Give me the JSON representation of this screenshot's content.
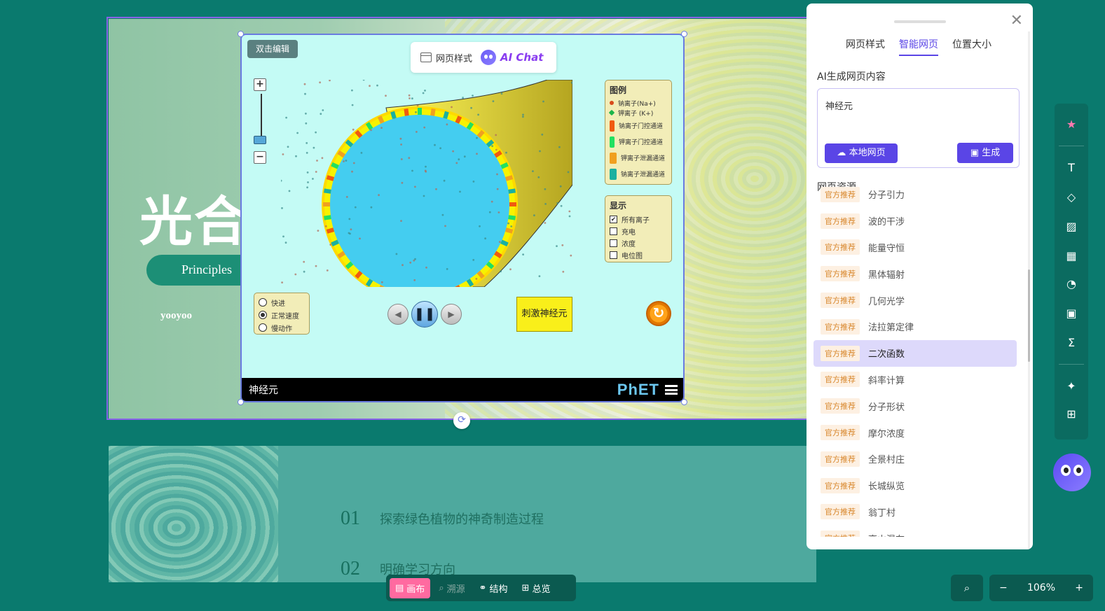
{
  "slide1": {
    "title": "光合作用",
    "pill_text": "Principles",
    "author": "yooyoo"
  },
  "slide2": {
    "items": [
      {
        "num": "01",
        "text": "探索绿色植物的神奇制造过程"
      },
      {
        "num": "02",
        "text": "明确学习方向"
      }
    ]
  },
  "sim": {
    "double_click_edit": "双击编辑",
    "toolbar": {
      "web_style": "网页样式",
      "ai_chat": "AI Chat"
    },
    "zoom_in": "+",
    "zoom_out": "−",
    "legend": {
      "title": "图例",
      "items": [
        "钠离子(Na+)",
        "钾离子 (K+)",
        "钠离子门控通道",
        "钾离子门控通道",
        "钾离子泄漏通道",
        "钠离子泄漏通道"
      ],
      "colors": [
        "#d84a1b",
        "#1bb54a",
        "#f05a10",
        "#22e060",
        "#f0a020",
        "#1ab0a0"
      ]
    },
    "display": {
      "title": "显示",
      "items": [
        {
          "label": "所有离子",
          "checked": true
        },
        {
          "label": "充电",
          "checked": false
        },
        {
          "label": "浓度",
          "checked": false
        },
        {
          "label": "电位图",
          "checked": false
        }
      ]
    },
    "speed": {
      "items": [
        {
          "label": "快进",
          "selected": false
        },
        {
          "label": "正常速度",
          "selected": true
        },
        {
          "label": "慢动作",
          "selected": false
        }
      ]
    },
    "stimulate": "刺激神经元",
    "footer_title": "神经元",
    "footer_logo": "PhET"
  },
  "panel": {
    "tabs": [
      "网页样式",
      "智能网页",
      "位置大小"
    ],
    "active_tab": 1,
    "ai_section": "AI生成网页内容",
    "ai_input": "神经元",
    "local_btn": "本地网页",
    "gen_btn": "生成",
    "res_section": "网页资源",
    "badge": "官方推荐",
    "resources": [
      "分子引力",
      "波的干涉",
      "能量守恒",
      "黑体辐射",
      "几何光学",
      "法拉第定律",
      "二次函数",
      "斜率计算",
      "分子形状",
      "摩尔浓度",
      "全景村庄",
      "长城纵览",
      "翁丁村",
      "高山瀑布"
    ],
    "selected_resource": 6
  },
  "bottom": {
    "modes": [
      "画布",
      "溯源",
      "结构",
      "总览"
    ],
    "zoom": "106%",
    "zoom_minus": "−",
    "zoom_plus": "+"
  },
  "colors": {
    "accent": "#5a45e6",
    "bg": "#0a7a6e",
    "badge": "#d8862a"
  }
}
